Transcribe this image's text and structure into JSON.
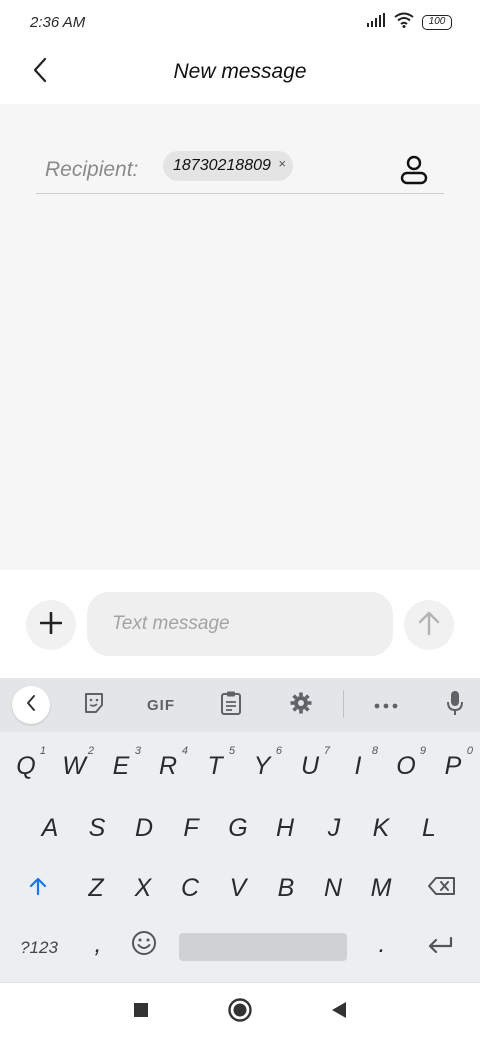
{
  "status_bar": {
    "time": "2:36 AM",
    "battery": "100",
    "icons": [
      "signal-icon",
      "wifi-icon",
      "battery-icon"
    ]
  },
  "header": {
    "title": "New message",
    "back_icon": "chevron-left-icon"
  },
  "recipient": {
    "label": "Recipient:",
    "chips": [
      {
        "value": "18730218809",
        "remove_symbol": "×"
      }
    ],
    "contact_icon": "person-icon"
  },
  "compose": {
    "placeholder": "Text message",
    "add_icon": "plus-icon",
    "send_icon": "arrow-up-icon"
  },
  "keyboard": {
    "toolbar": {
      "gif_label": "GIF",
      "items": [
        "chevron-left-icon",
        "sticker-icon",
        "gif",
        "clipboard-icon",
        "gear-icon",
        "more-icon",
        "mic-icon"
      ]
    },
    "row1": [
      {
        "key": "Q",
        "num": "1"
      },
      {
        "key": "W",
        "num": "2"
      },
      {
        "key": "E",
        "num": "3"
      },
      {
        "key": "R",
        "num": "4"
      },
      {
        "key": "T",
        "num": "5"
      },
      {
        "key": "Y",
        "num": "6"
      },
      {
        "key": "U",
        "num": "7"
      },
      {
        "key": "I",
        "num": "8"
      },
      {
        "key": "O",
        "num": "9"
      },
      {
        "key": "P",
        "num": "0"
      }
    ],
    "row2": [
      "A",
      "S",
      "D",
      "F",
      "G",
      "H",
      "J",
      "K",
      "L"
    ],
    "row3": [
      "Z",
      "X",
      "C",
      "V",
      "B",
      "N",
      "M"
    ],
    "row4": {
      "symbols": "?123",
      "comma": ",",
      "period": "."
    },
    "colors": {
      "shift": "#1a73e8",
      "background": "#eceff1",
      "toolbar": "#e3e5e7"
    }
  },
  "nav_bar": {
    "icons": [
      "recents-square-icon",
      "home-circle-icon",
      "back-triangle-icon"
    ]
  }
}
